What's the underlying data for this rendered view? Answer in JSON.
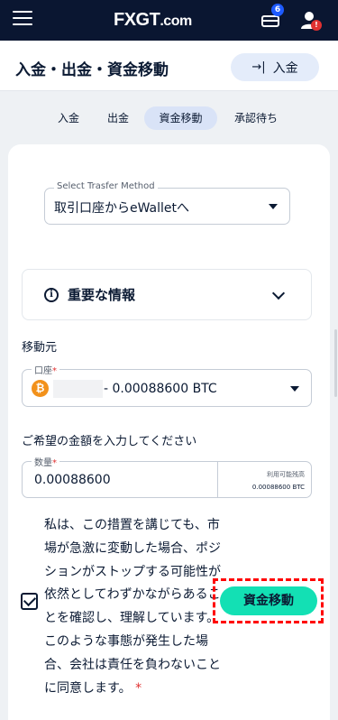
{
  "header": {
    "logo": "FXGT",
    "logo_suffix": ".com",
    "gift_badge": "6",
    "user_badge": "!"
  },
  "page": {
    "title": "入金・出金・資金移動",
    "deposit_button": "→| 入金",
    "deposit_label": "入金"
  },
  "tabs": [
    {
      "label": "入金",
      "active": false
    },
    {
      "label": "出金",
      "active": false
    },
    {
      "label": "資金移動",
      "active": true
    },
    {
      "label": "承認待ち",
      "active": false
    }
  ],
  "form": {
    "method_legend": "Select Trasfer Method",
    "method_value": "取引口座からeWalletへ",
    "info_title": "重要な情報",
    "source_label": "移動元",
    "account_legend": "口座",
    "account_value": "- 0.00088600 BTC",
    "amount_prompt": "ご希望の金額を入力してください",
    "amount_legend": "数量",
    "amount_value": "0.00088600",
    "available_label": "利用可能残高",
    "available_value": "0.00088600 BTC",
    "agreement_text": "私は、この措置を講じても、市場が急激に変動した場合、ポジションがストップする可能性が依然としてわずかながらあることを確認し、理解しています。このような事態が発生した場合、会社は責任を負わないことに同意します。",
    "agreement_checked": true,
    "submit_label": "資金移動"
  },
  "colors": {
    "header_bg": "#0a1631",
    "accent_green": "#13e0b4",
    "active_tab_bg": "#d9e3f7",
    "highlight_red": "#ff0000"
  }
}
